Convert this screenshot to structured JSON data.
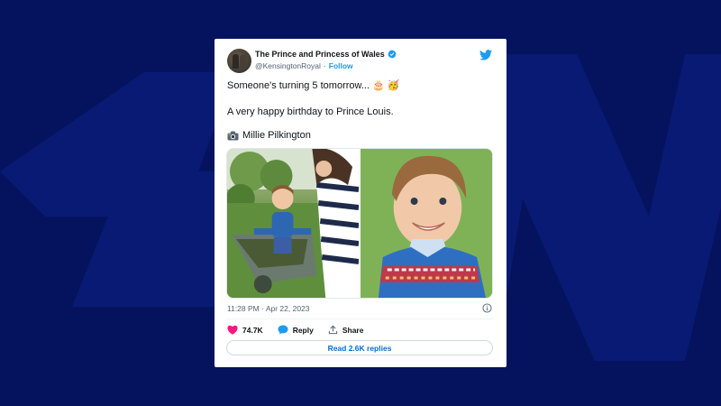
{
  "colors": {
    "background": "#05135e",
    "card": "#ffffff",
    "twitter_blue": "#1d9bf0",
    "like_pink": "#f91880"
  },
  "tweet": {
    "display_name": "The Prince and Princess of Wales",
    "handle": "@KensingtonRoyal",
    "separator": "·",
    "follow_label": "Follow",
    "verified_icon": "verified-badge-icon",
    "line1": "Someone's turning 5 tomorrow... 🎂 🥳",
    "line2": "A very happy birthday to Prince Louis.",
    "line3_icon": "camera-icon",
    "line3": "Millie Pilkington",
    "timestamp": "11:28 PM · Apr 22, 2023",
    "likes": "74.7K",
    "reply_label": "Reply",
    "share_label": "Share",
    "read_replies_label": "Read 2.6K replies"
  },
  "photos": [
    {
      "name": "photo-boy-in-wheelbarrow"
    },
    {
      "name": "photo-boy-portrait"
    }
  ]
}
